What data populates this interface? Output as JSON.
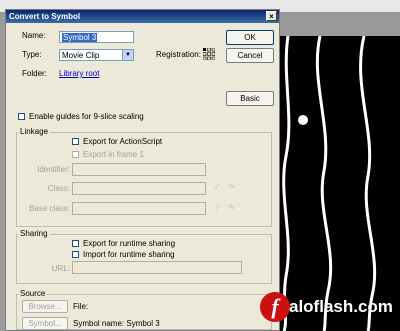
{
  "window": {
    "title": "Convert to Symbol",
    "close": "×"
  },
  "form": {
    "name_label": "Name:",
    "name_value": "Symbol 3",
    "type_label": "Type:",
    "type_value": "Movie Clip",
    "registration_label": "Registration:",
    "folder_label": "Folder:",
    "folder_link": "Library root"
  },
  "buttons": {
    "ok": "OK",
    "cancel": "Cancel",
    "basic": "Basic",
    "browse": "Browse...",
    "symbol": "Symbol..."
  },
  "options": {
    "nine_slice": "Enable guides for 9-slice scaling"
  },
  "linkage": {
    "title": "Linkage",
    "export_actionscript": "Export for ActionScript",
    "export_frame1": "Export in frame 1",
    "identifier": "Identifier:",
    "class": "Class:",
    "base_class": "Base class:"
  },
  "sharing": {
    "title": "Sharing",
    "export_runtime": "Export for runtime sharing",
    "import_runtime": "Import for runtime sharing",
    "url": "URL:"
  },
  "source": {
    "title": "Source",
    "file": "File:",
    "symbol_name": "Symbol name: Symbol 3"
  },
  "watermark": {
    "text": "aloflash.com",
    "logo_letter": "f"
  },
  "colors": {
    "title_bar": "#0a246a",
    "dialog_bg": "#ece9d8",
    "canvas_bg": "#000000",
    "link": "#0000cc"
  }
}
